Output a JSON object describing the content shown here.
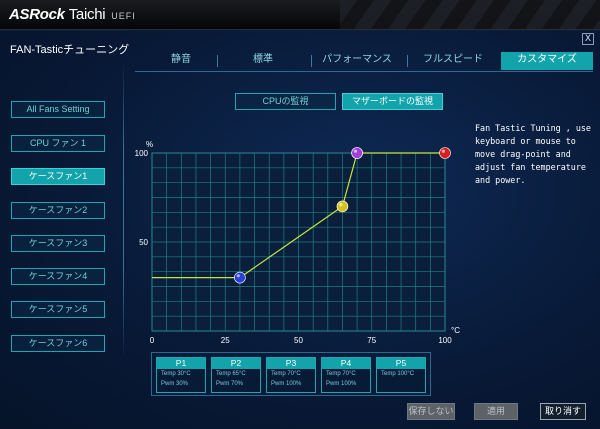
{
  "brand": {
    "name": "ASRock",
    "model": "Taichi",
    "firmware": "UEFI"
  },
  "page": {
    "title": "FAN-Tasticチューニング",
    "close_label": "X"
  },
  "sidebar": {
    "items": [
      {
        "label": "All Fans Setting",
        "active": false
      },
      {
        "label": "CPU ファン 1",
        "active": false
      },
      {
        "label": "ケースファン1",
        "active": true
      },
      {
        "label": "ケースファン2",
        "active": false
      },
      {
        "label": "ケースファン3",
        "active": false
      },
      {
        "label": "ケースファン4",
        "active": false
      },
      {
        "label": "ケースファン5",
        "active": false
      },
      {
        "label": "ケースファン6",
        "active": false
      }
    ]
  },
  "tabs": [
    {
      "label": "静音",
      "active": false
    },
    {
      "label": "標準",
      "active": false
    },
    {
      "label": "パフォーマンス",
      "active": false
    },
    {
      "label": "フルスピード",
      "active": false
    },
    {
      "label": "カスタマイズ",
      "active": true
    }
  ],
  "subtabs": [
    {
      "label": "CPUの監視",
      "active": false
    },
    {
      "label": "マザーボードの監視",
      "active": true
    }
  ],
  "help": {
    "text": "Fan Tastic Tuning , use keyboard or mouse to move drag-point and adjust fan temperature and power."
  },
  "chart_data": {
    "type": "line",
    "x_unit": "°C",
    "y_unit": "%",
    "xlim": [
      0,
      100
    ],
    "ylim": [
      0,
      100
    ],
    "x_ticks": [
      "0",
      "25",
      "50",
      "75",
      "100"
    ],
    "y_ticks": [
      "50",
      "100"
    ],
    "grid": true,
    "flat_start": {
      "x": 0,
      "y": 30
    },
    "points": [
      {
        "name": "P1",
        "x": 30,
        "y": 30,
        "color": "#2a3fd6"
      },
      {
        "name": "P2",
        "x": 65,
        "y": 70,
        "color": "#d6c21a"
      },
      {
        "name": "P3",
        "x": 70,
        "y": 100,
        "color": "#a23fd6"
      },
      {
        "name": "P4",
        "x": 70,
        "y": 100,
        "color": "#a23fd6"
      },
      {
        "name": "P5",
        "x": 100,
        "y": 100,
        "color": "#d62020"
      }
    ],
    "line_color": "#c8e63a",
    "grid_color": "#1f7f86"
  },
  "points_panel": [
    {
      "name": "P1",
      "temp": "Temp 30°C",
      "pwm": "Pwm  30%"
    },
    {
      "name": "P2",
      "temp": "Temp 65°C",
      "pwm": "Pwm  70%"
    },
    {
      "name": "P3",
      "temp": "Temp 70°C",
      "pwm": "Pwm  100%"
    },
    {
      "name": "P4",
      "temp": "Temp 70°C",
      "pwm": "Pwm  100%"
    },
    {
      "name": "P5",
      "temp": "Temp 100°C",
      "pwm": ""
    }
  ],
  "footer": {
    "save_label": "保存しない",
    "apply_label": "適用",
    "cancel_label": "取り消す"
  },
  "colors": {
    "accent": "#12a3ab",
    "background": "#0a1d3c"
  }
}
